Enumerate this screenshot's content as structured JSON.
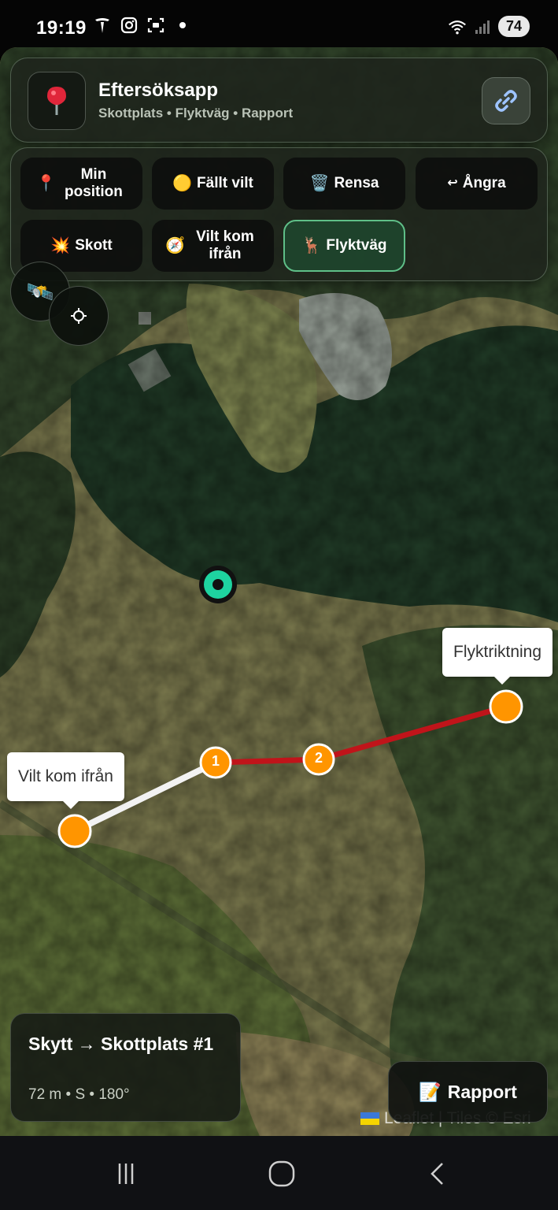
{
  "status_bar": {
    "time": "19:19",
    "battery": "74",
    "icons": [
      "tesla-icon",
      "instagram-icon",
      "screenshot-icon",
      "dot-icon",
      "wifi-icon",
      "signal-icon"
    ]
  },
  "header": {
    "title": "Eftersöksapp",
    "subtitle": "Skottplats • Flyktväg • Rapport",
    "logo_icon": "pin-icon",
    "link_icon": "link-icon"
  },
  "toolbar": {
    "buttons": [
      {
        "emoji": "📍",
        "label": "Min position",
        "active": false
      },
      {
        "emoji": "🟡",
        "label": "Fällt vilt",
        "active": false
      },
      {
        "emoji": "🗑️",
        "label": "Rensa",
        "active": false
      },
      {
        "emoji": "↩",
        "label": "Ångra",
        "active": false
      },
      {
        "emoji": "💥",
        "label": "Skott",
        "active": false
      },
      {
        "emoji": "🧭",
        "label": "Vilt kom ifrån",
        "active": false
      },
      {
        "emoji": "🦌",
        "label": "Flyktväg",
        "active": true
      }
    ]
  },
  "map_controls": {
    "satellite_icon": "🛰️",
    "locate_icon": "crosshair-icon"
  },
  "map": {
    "popups": {
      "start": "Vilt kom ifrån",
      "end": "Flyktriktning"
    },
    "waypoints": [
      "1",
      "2"
    ],
    "colors": {
      "route": "#c0141a",
      "from_line": "#f0f0f0",
      "marker": "#ff9500",
      "position": "#1ed3a0"
    }
  },
  "info": {
    "title": "Skytt → Skottplats #1",
    "stats": "72 m • S • 180°"
  },
  "report_button": {
    "emoji": "📝",
    "label": "Rapport"
  },
  "attribution": "Leaflet | Tiles © Esri"
}
